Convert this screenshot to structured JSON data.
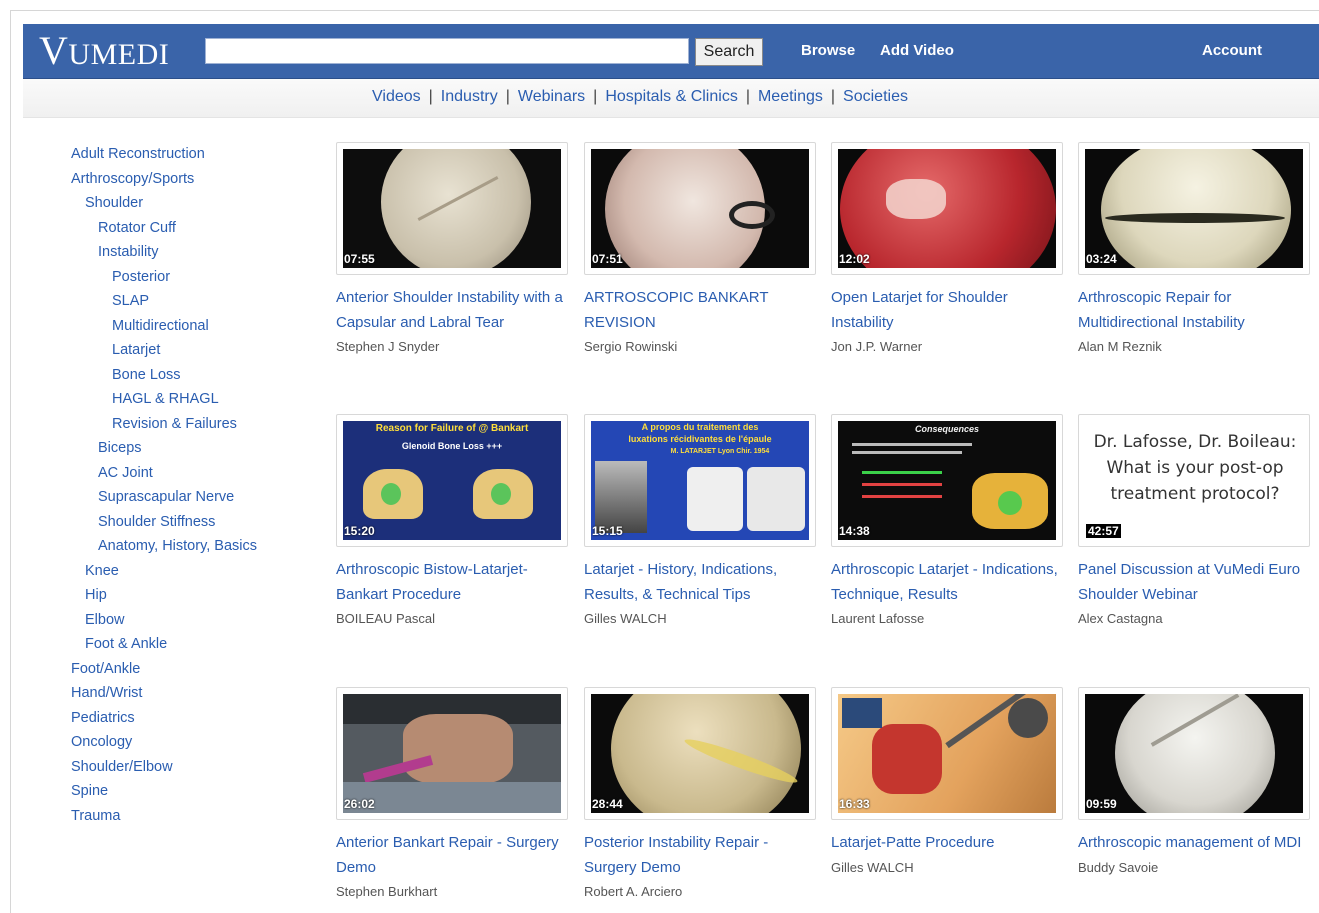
{
  "header": {
    "logo_first": "V",
    "logo_rest": "U",
    "logo_tail": "MEDI",
    "search_placeholder": "",
    "search_button": "Search",
    "browse": "Browse",
    "add_video": "Add Video",
    "account": "Account"
  },
  "subnav": {
    "items": [
      "Videos",
      "Industry",
      "Webinars",
      "Hospitals & Clinics",
      "Meetings",
      "Societies"
    ]
  },
  "sidebar": {
    "items": [
      {
        "label": "Adult Reconstruction",
        "level": 1
      },
      {
        "label": "Arthroscopy/Sports",
        "level": 1
      },
      {
        "label": "Shoulder",
        "level": 2
      },
      {
        "label": "Rotator Cuff",
        "level": 3
      },
      {
        "label": "Instability",
        "level": 3
      },
      {
        "label": "Posterior",
        "level": 4
      },
      {
        "label": "SLAP",
        "level": 4
      },
      {
        "label": "Multidirectional",
        "level": 4
      },
      {
        "label": "Latarjet",
        "level": 4
      },
      {
        "label": "Bone Loss",
        "level": 4
      },
      {
        "label": "HAGL & RHAGL",
        "level": 4
      },
      {
        "label": "Revision & Failures",
        "level": 4
      },
      {
        "label": "Biceps",
        "level": 3
      },
      {
        "label": "AC Joint",
        "level": 3
      },
      {
        "label": "Suprascapular Nerve",
        "level": 3
      },
      {
        "label": "Shoulder Stiffness",
        "level": 3
      },
      {
        "label": "Anatomy, History, Basics",
        "level": 3
      },
      {
        "label": "Knee",
        "level": 2
      },
      {
        "label": "Hip",
        "level": 2
      },
      {
        "label": "Elbow",
        "level": 2
      },
      {
        "label": "Foot & Ankle",
        "level": 2
      },
      {
        "label": "Foot/Ankle",
        "level": 1
      },
      {
        "label": "Hand/Wrist",
        "level": 1
      },
      {
        "label": "Pediatrics",
        "level": 1
      },
      {
        "label": "Oncology",
        "level": 1
      },
      {
        "label": "Shoulder/Elbow",
        "level": 1
      },
      {
        "label": "Spine",
        "level": 1
      },
      {
        "label": "Trauma",
        "level": 1
      }
    ]
  },
  "videos": [
    {
      "title": "Anterior Shoulder Instability with a Capsular and Labral Tear",
      "author": "Stephen J Snyder",
      "duration": "07:55"
    },
    {
      "title": "ARTROSCOPIC BANKART REVISION",
      "author": "Sergio Rowinski",
      "duration": "07:51"
    },
    {
      "title": "Open Latarjet for Shoulder Instability",
      "author": "Jon J.P. Warner",
      "duration": "12:02"
    },
    {
      "title": "Arthroscopic Repair for Multidirectional Instability",
      "author": "Alan M Reznik",
      "duration": "03:24"
    },
    {
      "title": "Arthroscopic Bistow-Latarjet-Bankart Procedure",
      "author": "BOILEAU Pascal",
      "duration": "15:20"
    },
    {
      "title": "Latarjet - History, Indications, Results, & Technical Tips",
      "author": "Gilles WALCH",
      "duration": "15:15"
    },
    {
      "title": "Arthroscopic Latarjet - Indications, Technique, Results",
      "author": "Laurent Lafosse",
      "duration": "14:38"
    },
    {
      "title": "Panel Discussion at VuMedi Euro Shoulder Webinar",
      "author": "Alex Castagna",
      "duration": "42:57"
    },
    {
      "title": "Anterior Bankart Repair - Surgery Demo",
      "author": "Stephen Burkhart",
      "duration": "26:02"
    },
    {
      "title": "Posterior Instability Repair - Surgery Demo",
      "author": "Robert A. Arciero",
      "duration": "28:44"
    },
    {
      "title": "Latarjet-Patte Procedure",
      "author": "Gilles WALCH",
      "duration": "16:33"
    },
    {
      "title": "Arthroscopic management of MDI",
      "author": "Buddy Savoie",
      "duration": "09:59"
    }
  ],
  "thumb_text": {
    "t5_line1": "Reason for Failure of @ Bankart",
    "t5_line2": "Glenoid Bone Loss +++",
    "t6_line1": "A propos du traitement des",
    "t6_line2": "luxations récidivantes de l'épaule",
    "t6_line3": "M. LATARJET Lyon Chir. 1954",
    "t7_line1": "Consequences",
    "t8_text": "Dr. Lafosse, Dr. Boileau: What is your post-op treatment protocol?"
  }
}
